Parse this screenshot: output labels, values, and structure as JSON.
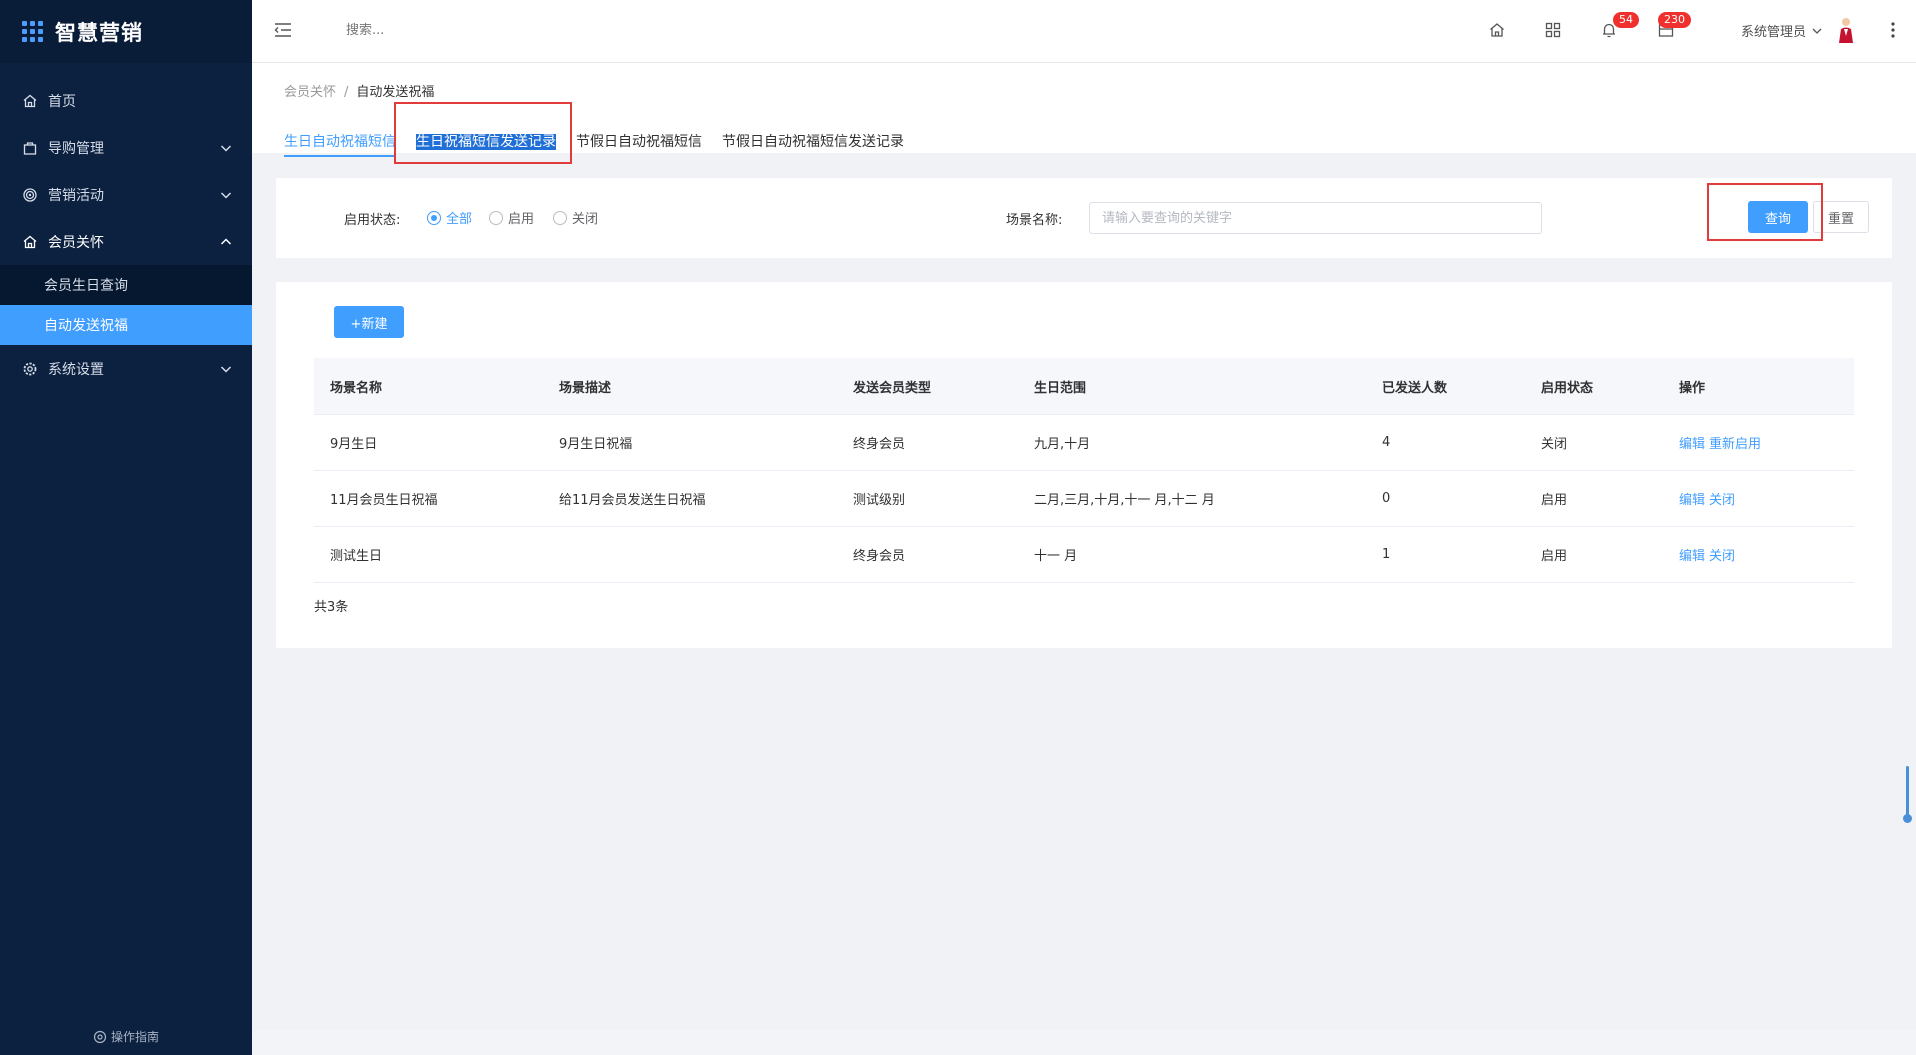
{
  "app": {
    "title": "智慧营销"
  },
  "sidebar": {
    "items": [
      {
        "label": "首页",
        "icon": "home-icon"
      },
      {
        "label": "导购管理",
        "icon": "bag-icon"
      },
      {
        "label": "营销活动",
        "icon": "target-icon"
      },
      {
        "label": "会员关怀",
        "icon": "home-icon"
      },
      {
        "label": "系统设置",
        "icon": "gear-icon"
      }
    ],
    "submenu": [
      {
        "label": "会员生日查询"
      },
      {
        "label": "自动发送祝福"
      }
    ],
    "guide": "操作指南"
  },
  "header": {
    "search_placeholder": "搜索...",
    "notifications_count": "54",
    "messages_count": "230",
    "user_name": "系统管理员"
  },
  "breadcrumb": {
    "parent": "会员关怀",
    "sep": "/",
    "current": "自动发送祝福"
  },
  "tabs": [
    {
      "label": "生日自动祝福短信"
    },
    {
      "label": "生日祝福短信发送记录"
    },
    {
      "label": "节假日自动祝福短信"
    },
    {
      "label": "节假日自动祝福短信发送记录"
    }
  ],
  "filter": {
    "status_label": "启用状态:",
    "options": [
      "全部",
      "启用",
      "关闭"
    ],
    "selected": "全部",
    "scene_label": "场景名称:",
    "scene_placeholder": "请输入要查询的关键字",
    "query_button": "查询",
    "reset_button": "重置"
  },
  "table": {
    "new_button": "+新建",
    "columns": [
      "场景名称",
      "场景描述",
      "发送会员类型",
      "生日范围",
      "已发送人数",
      "启用状态",
      "操作"
    ],
    "rows": [
      {
        "name": "9月生日",
        "desc": "9月生日祝福",
        "type": "终身会员",
        "range": "九月,十月",
        "sent": "4",
        "status": "关闭",
        "ops": [
          "编辑",
          "重新启用"
        ]
      },
      {
        "name": "11月会员生日祝福",
        "desc": "给11月会员发送生日祝福",
        "type": "测试级别",
        "range": "二月,三月,十月,十一 月,十二 月",
        "sent": "0",
        "status": "启用",
        "ops": [
          "编辑",
          "关闭"
        ]
      },
      {
        "name": "测试生日",
        "desc": "",
        "type": "终身会员",
        "range": "十一 月",
        "sent": "1",
        "status": "启用",
        "ops": [
          "编辑",
          "关闭"
        ]
      }
    ],
    "total": "共3条"
  },
  "colors": {
    "primary": "#409eff",
    "sidebar": "#0c2140",
    "badge": "#f0302c",
    "highlight": "#e23b3b"
  }
}
